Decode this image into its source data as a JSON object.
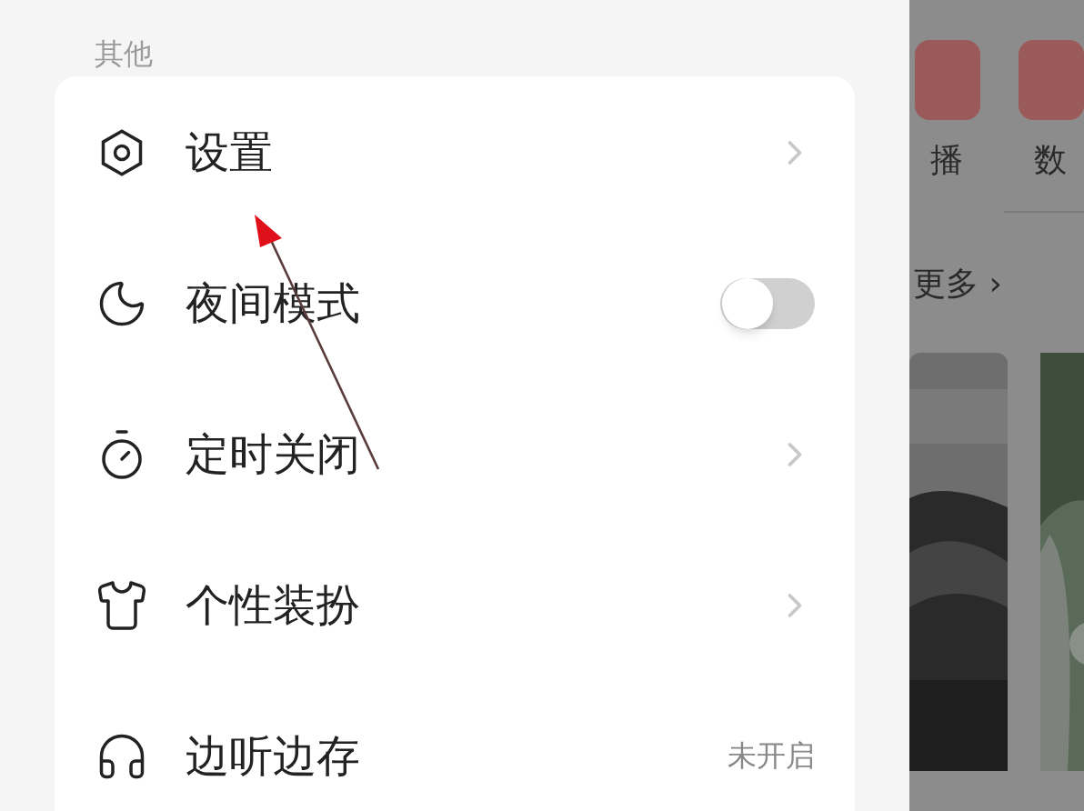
{
  "drawer": {
    "section_title": "其他",
    "items": [
      {
        "kind": "link",
        "label": "设置"
      },
      {
        "kind": "toggle",
        "label": "夜间模式",
        "on": false
      },
      {
        "kind": "link",
        "label": "定时关闭"
      },
      {
        "kind": "link",
        "label": "个性装扮"
      },
      {
        "kind": "value",
        "label": "边听边存",
        "value": "未开启"
      }
    ]
  },
  "background": {
    "shortcuts": [
      "播",
      "数"
    ],
    "more_link": "更多 ›"
  }
}
